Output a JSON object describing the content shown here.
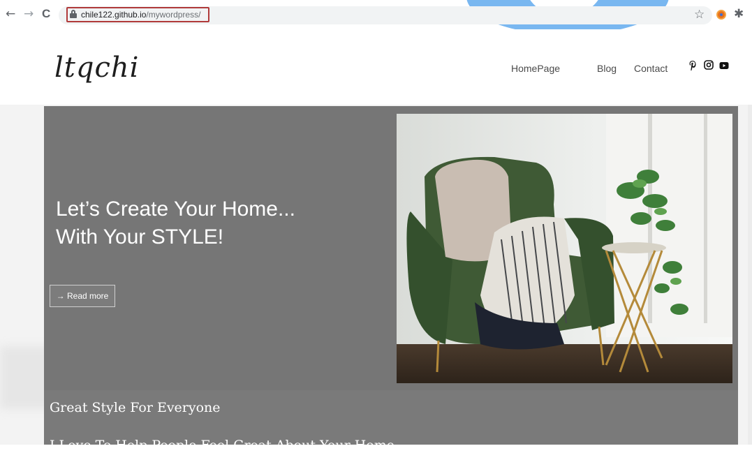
{
  "browser": {
    "back": "←",
    "forward": "→",
    "reload": "C",
    "url_domain": "chile122.github.io",
    "url_path": "/mywordpress/",
    "star": "☆",
    "extensions": "✱"
  },
  "site": {
    "logo": "ltqchi",
    "menu": [
      "HomePage",
      "Blog",
      "Contact"
    ],
    "social_icons": [
      "pinterest-icon",
      "instagram-icon",
      "youtube-icon"
    ]
  },
  "hero": {
    "title_line1": "Let’s Create Your Home...",
    "title_line2": "With Your STYLE!",
    "read_more": "→ Read more"
  },
  "section": {
    "title": "Great Style For Everyone",
    "subtitle": "I Love To Help People Feel Great About Your Home"
  },
  "colors": {
    "hero_bg": "#767676",
    "chair_green": "#3f5a35",
    "url_highlight": "#b03a3a"
  }
}
